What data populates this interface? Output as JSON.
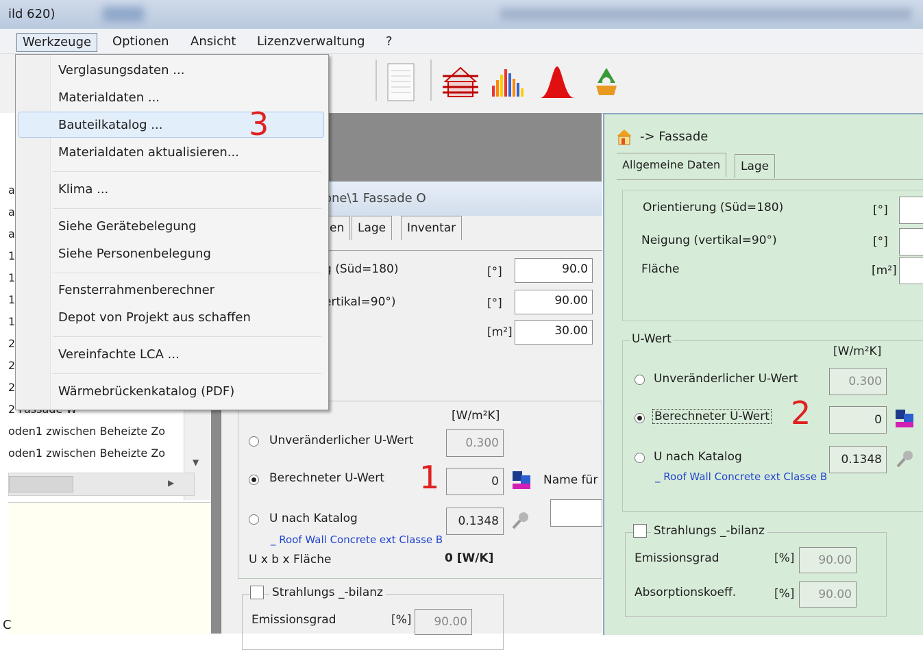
{
  "window": {
    "title": "ild 620)"
  },
  "menubar": {
    "items": [
      "Werkzeuge",
      "Optionen",
      "Ansicht",
      "Lizenzverwaltung",
      "?"
    ]
  },
  "dropdown": {
    "items": [
      "Verglasungsdaten ...",
      "Materialdaten ...",
      "Bauteilkatalog ...",
      "Materialdaten aktualisieren...",
      "Klima ...",
      "Siehe Gerätebelegung",
      "Siehe Personenbelegung",
      "Fensterrahmenberechner",
      "Depot von Projekt aus schaffen",
      "Vereinfachte LCA ...",
      "Wärmebrückenkatalog (PDF)"
    ],
    "highlighted": "Bauteilkatalog ..."
  },
  "annotations": {
    "one": "1",
    "two": "2",
    "three": "3"
  },
  "left_list": {
    "row_prefixes": [
      "a",
      "a",
      "a",
      "1",
      "1",
      "1",
      "1",
      "2",
      "2",
      "2"
    ],
    "rows": [
      "2 Fassade W",
      "oden1 zwischen Beheizte Zo",
      "oden1 zwischen Beheizte Zo"
    ],
    "bottom_char": "C"
  },
  "middle": {
    "title": "one\\1 Fassade O",
    "tabs": [
      "en",
      "Lage",
      "Inventar"
    ],
    "orientierung_label": "g (Süd=180)",
    "neigung_label": "ertikal=90°)",
    "unit_deg": "[°]",
    "unit_m2": "[m²]",
    "orientierung_value": "90.0",
    "neigung_value": "90.00",
    "flaeche_value": "30.00",
    "uwert_unit": "[W/m²K]",
    "radio_fixed": "Unveränderlicher U-Wert",
    "fixed_value": "0.300",
    "radio_calc": "Berechneter U-Wert",
    "calc_value": "0",
    "name_fuer": "Name für",
    "radio_catalog": "U nach Katalog",
    "catalog_value": "0.1348",
    "catalog_link": "_ Roof Wall Concrete ext Classe B",
    "uxbxflaeche_label": "U x b x Fläche",
    "uxbxflaeche_value": "0 [W/K]",
    "strahlung_label": "Strahlungs _-bilanz",
    "emission_label": "Emissionsgrad",
    "percent_unit": "[%]",
    "emission_value": "90.00"
  },
  "right": {
    "title": "-> Fassade",
    "tabs": [
      "Allgemeine Daten",
      "Lage"
    ],
    "orientierung_label": "Orientierung (Süd=180)",
    "neigung_label": "Neigung  (vertikal=90°)",
    "flaeche_label": "Fläche",
    "unit_deg": "[°]",
    "unit_m2": "[m²]",
    "uwert_group": "U-Wert",
    "uwert_unit": "[W/m²K]",
    "radio_fixed": "Unveränderlicher U-Wert",
    "fixed_value": "0.300",
    "radio_calc": "Berechneter U-Wert",
    "calc_value": "0",
    "radio_catalog": "U nach Katalog",
    "catalog_value": "0.1348",
    "catalog_link": "_ Roof Wall Concrete ext Classe B",
    "strahlung_label": "Strahlungs _-bilanz",
    "emission_label": "Emissionsgrad",
    "absorption_label": "Absorptionskoeff.",
    "percent_unit": "[%]",
    "emission_value": "90.00",
    "absorption_value": "90.00"
  }
}
